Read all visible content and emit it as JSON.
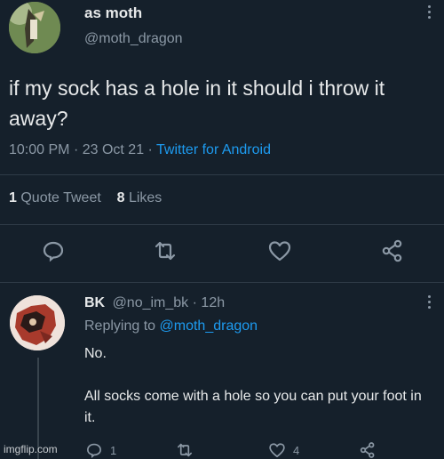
{
  "tweet": {
    "display_name": "as moth",
    "handle": "@moth_dragon",
    "text": "if my sock has a hole in it should i throw it away?",
    "time": "10:00 PM",
    "date": "23 Oct 21",
    "sep": "·",
    "source": "Twitter for Android",
    "stats": {
      "quote_count": "1",
      "quote_label": "Quote Tweet",
      "like_count": "8",
      "like_label": "Likes"
    },
    "icons": [
      "reply-icon",
      "retweet-icon",
      "like-icon",
      "share-icon"
    ]
  },
  "reply": {
    "display_name": "BK",
    "handle": "@no_im_bk",
    "sep": "·",
    "age": "12h",
    "replying_label": "Replying to",
    "replying_to": "@moth_dragon",
    "line1": "No.",
    "line2": "All socks come with a hole so you can put your foot in it.",
    "reply_count": "1",
    "like_count": "4"
  },
  "watermark": "imgflip.com",
  "colors": {
    "background": "#15202b",
    "text": "#e7e9ea",
    "muted": "#8b98a5",
    "accent": "#1d9bf0"
  }
}
